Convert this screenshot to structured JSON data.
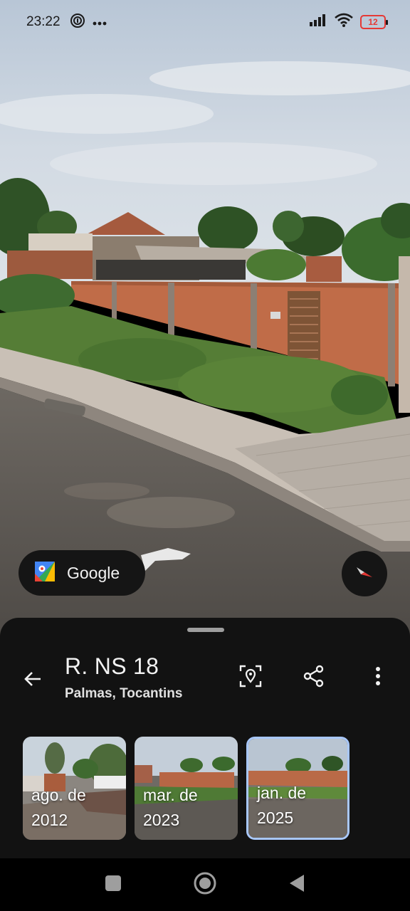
{
  "status_bar": {
    "time": "23:22",
    "battery": "12",
    "battery_color": "#e53935"
  },
  "street_view": {
    "attribution": "Google",
    "compass_icon": "compass-icon"
  },
  "location": {
    "street": "R. NS 18",
    "city": "Palmas, Tocantins"
  },
  "actions": {
    "back": "arrow-back-icon",
    "capture": "image-search-icon",
    "share": "share-icon",
    "more": "more-vert-icon"
  },
  "timeline": [
    {
      "label": "ago. de\n2012",
      "selected": false
    },
    {
      "label": "mar. de\n2023",
      "selected": false
    },
    {
      "label": "jan. de\n2025",
      "selected": true
    }
  ],
  "nav": {
    "recents": "square-icon",
    "home": "circle-icon",
    "back": "triangle-back-icon"
  },
  "colors": {
    "sheet_bg": "#121212",
    "chip_bg": "#151515",
    "selected_border": "#a8c7fa"
  }
}
